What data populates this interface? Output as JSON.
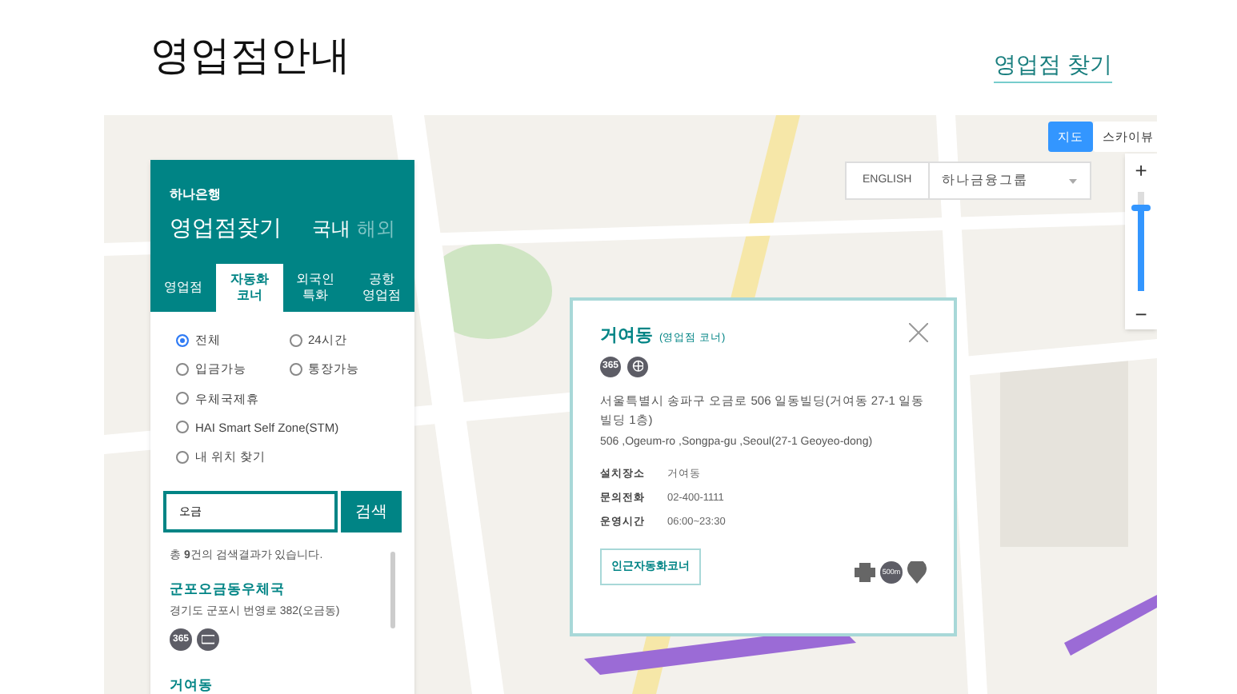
{
  "page_title": "영업점안내",
  "find_link": "영업점 찾기",
  "map_type_buttons": [
    {
      "label": "지도",
      "selected": true
    },
    {
      "label": "스카이뷰",
      "selected": false
    }
  ],
  "language_button": "ENGLISH",
  "group_select": {
    "value": "하나금융그룹"
  },
  "zoom": {
    "plus": "+",
    "minus": "−",
    "level": 0.8
  },
  "panel": {
    "brand": "하나은행",
    "title": "영업점찾기",
    "regions": [
      {
        "label": "국내",
        "selected": true
      },
      {
        "label": "해외",
        "selected": false
      }
    ],
    "tabs": [
      {
        "label": "영업점",
        "selected": false
      },
      {
        "label": "자동화\n코너",
        "selected": true
      },
      {
        "label": "외국인\n특화",
        "selected": false
      },
      {
        "label": "공항\n영업점",
        "selected": false
      }
    ],
    "filters": [
      {
        "label": "전체",
        "selected": true
      },
      {
        "label": "24시간",
        "selected": false
      },
      {
        "label": "입금가능",
        "selected": false
      },
      {
        "label": "통장가능",
        "selected": false
      },
      {
        "label": "우체국제휴",
        "selected": false
      },
      {
        "label": "HAI Smart Self Zone(STM)",
        "selected": false
      },
      {
        "label": "내 위치 찾기",
        "selected": false
      }
    ],
    "search": {
      "value": "오금",
      "button": "검색"
    },
    "result_count": "총 **9**건의 검색결과가 있습니다.",
    "results": [
      {
        "name": "군포오금동우체국",
        "address": "경기도 군포시 번영로 382(오금동)",
        "badges": [
          {
            "kind": "text",
            "label": "365"
          },
          {
            "kind": "atm"
          }
        ]
      },
      {
        "name": "거여동"
      }
    ]
  },
  "popup": {
    "name": "거여동",
    "type": "(영업점 코너)",
    "badges": [
      {
        "kind": "text",
        "label": "365"
      },
      {
        "kind": "globe"
      }
    ],
    "address_ko": "서울특별시 송파구 오금로 506 일동빌딩(거여동 27-1 일동빌딩 1층)",
    "address_en": "506 ,Ogeum-ro ,Songpa-gu ,Seoul(27-1 Geoyeo-dong)",
    "details": [
      {
        "label": "설치장소",
        "value": "거여동"
      },
      {
        "label": "문의전화",
        "value": "02-400-1111"
      },
      {
        "label": "운영시간",
        "value": "06:00~23:30"
      }
    ],
    "nearby_button": "인근자동화코너",
    "distance": "500m"
  }
}
